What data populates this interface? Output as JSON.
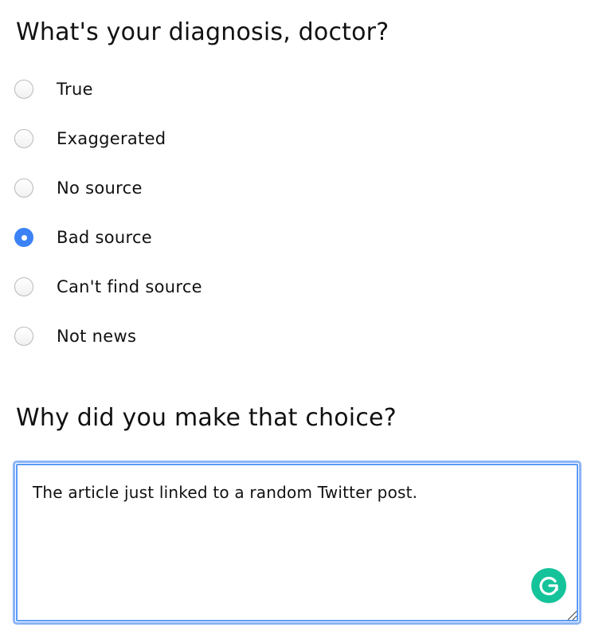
{
  "question1": {
    "title": "What's your diagnosis, doctor?",
    "options": [
      {
        "label": "True",
        "checked": false
      },
      {
        "label": "Exaggerated",
        "checked": false
      },
      {
        "label": "No source",
        "checked": false
      },
      {
        "label": "Bad source",
        "checked": true
      },
      {
        "label": "Can't find source",
        "checked": false
      },
      {
        "label": "Not news",
        "checked": false
      }
    ]
  },
  "question2": {
    "title": "Why did you make that choice?",
    "answer": "The article just linked to a random Twitter post."
  },
  "colors": {
    "radio_checked": "#3b82f6",
    "focus_ring": "#5a9bf7",
    "grammarly": "#15c39a"
  },
  "icons": {
    "grammarly": "grammarly-g-icon",
    "resize": "resize-handle-icon"
  }
}
